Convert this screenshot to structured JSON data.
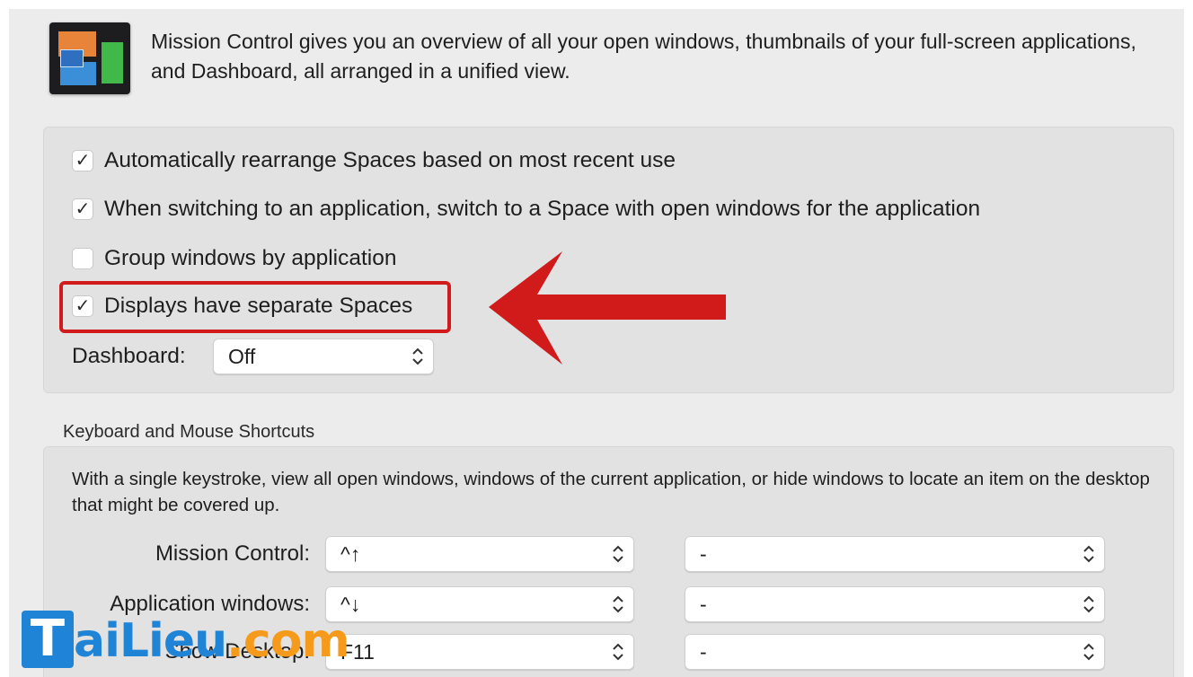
{
  "header": {
    "description": "Mission Control gives you an overview of all your open windows, thumbnails of your full-screen applications, and Dashboard, all arranged in a unified view.",
    "icon": "mission-control-icon"
  },
  "options": [
    {
      "label": "Automatically rearrange Spaces based on most recent use",
      "checked": true,
      "mark": "✓"
    },
    {
      "label": "When switching to an application, switch to a Space with open windows for the application",
      "checked": true,
      "mark": "✓"
    },
    {
      "label": "Group windows by application",
      "checked": false,
      "mark": ""
    },
    {
      "label": "Displays have separate Spaces",
      "checked": true,
      "mark": "✓"
    }
  ],
  "dashboard": {
    "label": "Dashboard:",
    "value": "Off"
  },
  "annotation": {
    "highlight_color": "#d11a1a",
    "arrow": "left-pointing red arrow"
  },
  "shortcuts": {
    "title": "Keyboard and Mouse Shortcuts",
    "help": "With a single keystroke, view all open windows, windows of the current application, or hide windows to locate an item on the desktop that might be covered up.",
    "rows": [
      {
        "label": "Mission Control:",
        "key": "^↑",
        "mouse": "-"
      },
      {
        "label": "Application windows:",
        "key": "^↓",
        "mouse": "-"
      },
      {
        "label": "Show Desktop:",
        "key": "F11",
        "mouse": "-"
      }
    ]
  },
  "watermark": {
    "box": "T",
    "part1": "aiLieu",
    "part2": ".com"
  },
  "colors": {
    "accent_red": "#d11a1a",
    "watermark_blue": "#1f84d6",
    "watermark_orange": "#f59a1b"
  }
}
